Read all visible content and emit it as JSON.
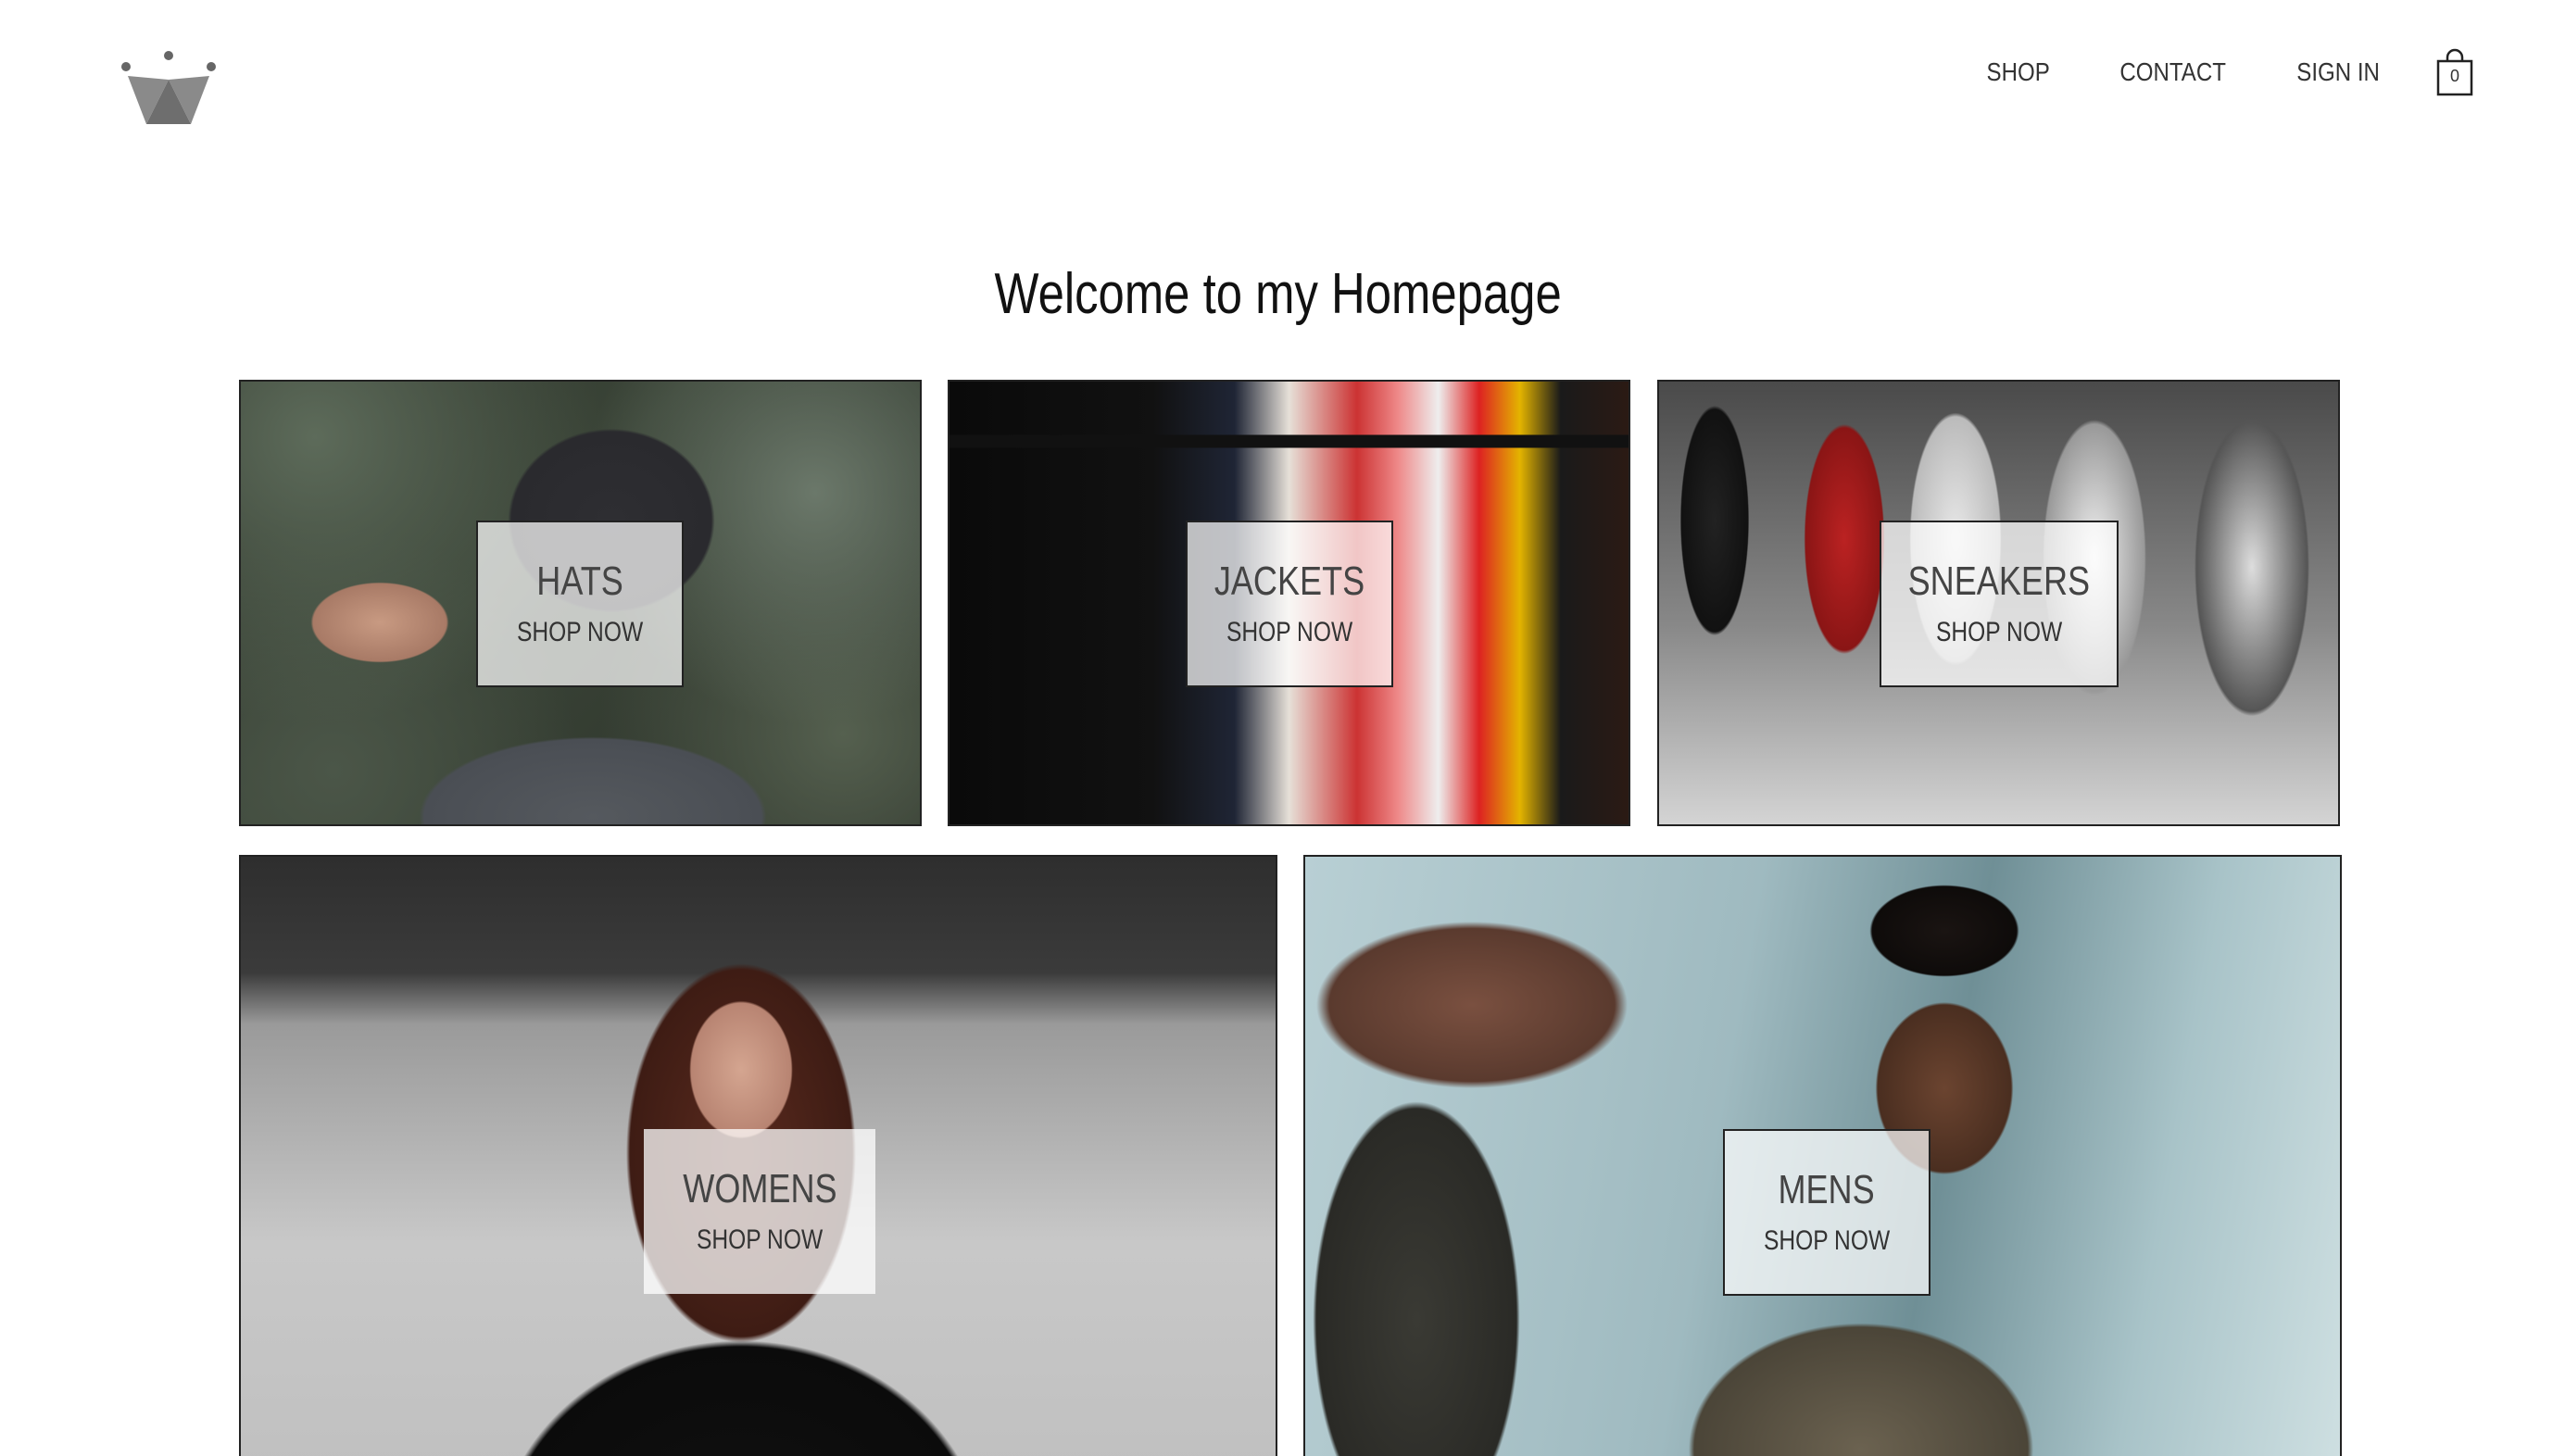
{
  "header": {
    "logo_name": "crown-logo",
    "nav": {
      "shop": "SHOP",
      "contact": "CONTACT",
      "sign_in": "SIGN IN"
    },
    "cart_count": "0"
  },
  "main": {
    "title": "Welcome to my Homepage",
    "categories": [
      {
        "title": "HATS",
        "cta": "SHOP NOW"
      },
      {
        "title": "JACKETS",
        "cta": "SHOP NOW"
      },
      {
        "title": "SNEAKERS",
        "cta": "SHOP NOW"
      },
      {
        "title": "WOMENS",
        "cta": "SHOP NOW"
      },
      {
        "title": "MENS",
        "cta": "SHOP NOW"
      }
    ]
  },
  "colors": {
    "text": "#222222",
    "logo_gray": "#777777",
    "background": "#ffffff"
  }
}
